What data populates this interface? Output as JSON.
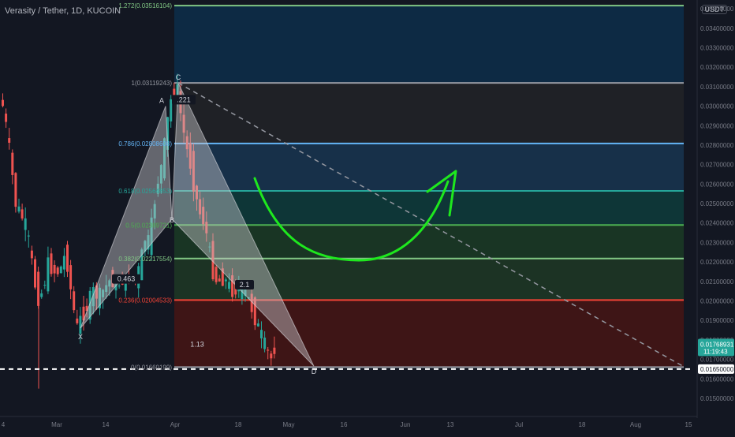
{
  "header": {
    "symbol_title": "Verasity / Tether, 1D, KUCOIN",
    "currency_badge": "USDT"
  },
  "colors": {
    "background": "#131722",
    "up_candle": "#26a69a",
    "down_candle": "#ef5350",
    "axis_text": "#787b86"
  },
  "chart_data": {
    "type": "candlestick",
    "y_axis": {
      "ticks": [
        "0.01500000",
        "0.01600000",
        "0.01700000",
        "0.01800000",
        "0.01900000",
        "0.02000000",
        "0.02100000",
        "0.02200000",
        "0.02300000",
        "0.02400000",
        "0.02500000",
        "0.02600000",
        "0.02700000",
        "0.02800000",
        "0.02900000",
        "0.03000000",
        "0.03100000",
        "0.03200000",
        "0.03300000",
        "0.03400000",
        "0.03500000"
      ],
      "ylim": [
        0.01435,
        0.03545
      ],
      "last_price": "0.01768931",
      "countdown": "11:19:43",
      "line_price": "0.01650000"
    },
    "x_axis": {
      "ticks": [
        "4",
        "Mar",
        "14",
        "Apr",
        "18",
        "May",
        "16",
        "Jun",
        "13",
        "Jul",
        "18",
        "Aug",
        "15"
      ]
    },
    "fibonacci_levels": [
      {
        "ratio": 1.272,
        "label": "1.272(0.03516104)",
        "value": 0.03516104,
        "color": "#81c784"
      },
      {
        "ratio": 1.0,
        "label": "1(0.03119243)",
        "value": 0.03119243,
        "color": "#9598a1"
      },
      {
        "ratio": 0.786,
        "label": "0.786(0.02808608)",
        "value": 0.02808608,
        "color": "#64b5f6"
      },
      {
        "ratio": 0.618,
        "label": "0.618(0.02564853)",
        "value": 0.02564853,
        "color": "#26a69a"
      },
      {
        "ratio": 0.5,
        "label": "0.5(0.02389721)",
        "value": 0.02389721,
        "color": "#4caf50"
      },
      {
        "ratio": 0.382,
        "label": "0.382(0.02217554)",
        "value": 0.02217554,
        "color": "#81c784"
      },
      {
        "ratio": 0.236,
        "label": "0.236(0.02004533)",
        "value": 0.02004533,
        "color": "#f44336"
      },
      {
        "ratio": 0.0,
        "label": "0(0.01660199)",
        "value": 0.01660199,
        "color": "#9598a1"
      }
    ],
    "harmonic_pattern": {
      "points": [
        {
          "label": "X",
          "value": 0.0186
        },
        {
          "label": "A",
          "value": 0.03
        },
        {
          "label": "B",
          "value": 0.0242
        },
        {
          "label": "C",
          "value": 0.03119
        },
        {
          "label": "D",
          "value": 0.01665
        }
      ],
      "ratios": [
        {
          "label": "0.463"
        },
        {
          "label": ".221"
        },
        {
          "label": "2.1"
        },
        {
          "label": "1.13"
        }
      ]
    }
  }
}
